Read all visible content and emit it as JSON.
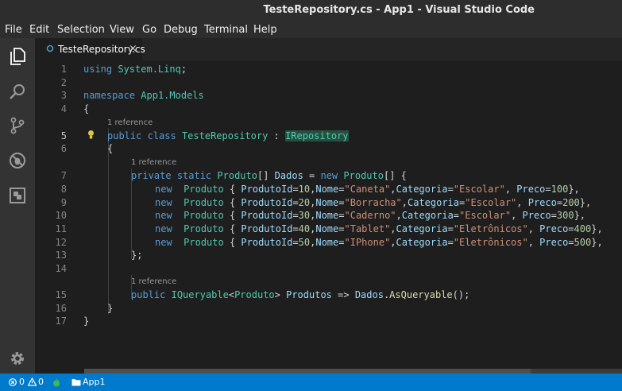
{
  "window": {
    "title": "TesteRepository.cs - App1 - Visual Studio Code"
  },
  "menu": [
    "File",
    "Edit",
    "Selection",
    "View",
    "Go",
    "Debug",
    "Terminal",
    "Help"
  ],
  "tab": {
    "label": "TesteRepository.cs",
    "close": "×"
  },
  "lens": {
    "reference": "1 reference"
  },
  "editor": {
    "line_numbers": [
      "1",
      "2",
      "3",
      "4",
      "5",
      "6",
      "7",
      "8",
      "9",
      "10",
      "11",
      "12",
      "13",
      "14",
      "15",
      "16",
      "17"
    ]
  },
  "statusbar": {
    "errors": "0",
    "warnings": "0",
    "folder": "App1"
  },
  "colors": {
    "accent": "#007acc",
    "keyword": "#569cd6",
    "type": "#4ec9b0",
    "string": "#ce9178",
    "number": "#b5cea8"
  }
}
